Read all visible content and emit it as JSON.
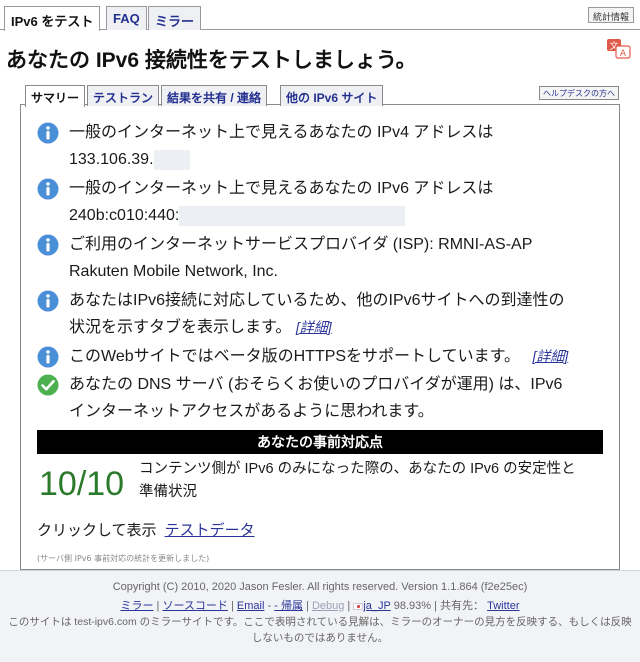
{
  "nav": {
    "tabs": [
      {
        "label": "IPv6 をテスト"
      },
      {
        "label": "FAQ"
      },
      {
        "label": "ミラー"
      }
    ],
    "stats_button": "統計情報"
  },
  "page_title": "あなたの IPv6 接続性をテストしましょう。",
  "subtabs": [
    {
      "label": "サマリー"
    },
    {
      "label": "テストラン"
    },
    {
      "label": "結果を共有 / 連絡"
    },
    {
      "label": "他の IPv6 サイト"
    }
  ],
  "helpdesk_button": "ヘルプデスクの方へ",
  "results": [
    {
      "line1": "一般のインターネット上で見えるあなたの IPv4 アドレスは",
      "line2": "133.106.39."
    },
    {
      "line1": "一般のインターネット上で見えるあなたの IPv6 アドレスは",
      "line2": "240b:c010:440:"
    },
    {
      "line1": "ご利用のインターネットサービスプロバイダ (ISP): RMNI-AS-AP",
      "line2": "Rakuten Mobile Network, Inc."
    },
    {
      "line1": "あなたはIPv6接続に対応しているため、他のIPv6サイトへの到達性の",
      "line2": "状況を示すタブを表示します。",
      "link": "[詳細]"
    },
    {
      "line1": "このWebサイトではベータ版のHTTPSをサポートしています。",
      "link": "[詳細]"
    },
    {
      "line1": "あなたの DNS サーバ (おそらくお使いのプロバイダが運用) は、IPv6",
      "line2": "インターネットアクセスがあるように思われます。"
    }
  ],
  "readiness": {
    "heading": "あなたの事前対応点",
    "score": "10/10",
    "desc_line1": "コンテンツ側が IPv6 のみになった際の、あなたの IPv6 の安定性と",
    "desc_line2": "準備状況"
  },
  "click_to_show": "クリックして表示",
  "test_data_link": "テストデータ",
  "server_note": "(サーバ側 IPv6 事前対応の統計を更新しました)",
  "footer": {
    "copyright": "Copyright (C) 2010, 2020 Jason Fesler. All rights reserved. Version 1.1.864 (f2e25ec)",
    "links": {
      "mirror": "ミラー",
      "sep1": " | ",
      "source": "ソースコード",
      "sep2": " | ",
      "email": "Email",
      "sep3": " - ",
      "attribution": " - 帰属",
      "sep4": " | ",
      "debug": "Debug",
      "sep5": " | ",
      "lang": "ja_JP",
      "lang_pct": " 98.93%",
      "sep6": " | 共有先：",
      "twitter": "Twitter"
    },
    "mirror_note": "このサイトは test-ipv6.com のミラーサイトです。ここで表明されている見解は、ミラーのオーナーの見方を反映する、もしくは反映しないものではありません。"
  },
  "colors": {
    "info_icon": "#4a8fd6",
    "check_icon": "#4caf50",
    "score": "#2b7a2b",
    "link": "#2a3599"
  }
}
